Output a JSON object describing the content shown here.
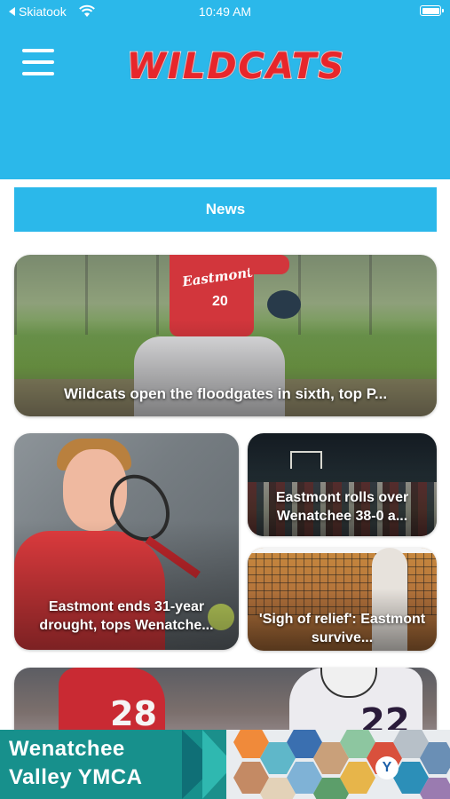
{
  "status_bar": {
    "back_app": "Skiatook",
    "time": "10:49 AM"
  },
  "header": {
    "logo_text": "WILDCATS",
    "menu_icon": "hamburger-menu-icon"
  },
  "section": {
    "title": "News"
  },
  "news_cards": [
    {
      "title": "Wildcats open the floodgates in sixth, top P..."
    },
    {
      "title": "Eastmont ends 31-year drought, tops Wenatche..."
    },
    {
      "title": "Eastmont rolls over Wenatchee 38-0 a..."
    },
    {
      "title": "'Sigh of relief': Eastmont survive..."
    },
    {
      "title": ""
    }
  ],
  "photo_text": {
    "jersey_brand": "Eastmont",
    "jersey_number": "20",
    "football_number_white": "22",
    "football_number_red": "28"
  },
  "ad": {
    "line1": "Wenatchee",
    "line2": "Valley YMCA",
    "logo_letter": "Y"
  },
  "colors": {
    "header_blue": "#2bb8ea",
    "logo_red": "#e8262b",
    "ad_teal": "#17908c"
  }
}
